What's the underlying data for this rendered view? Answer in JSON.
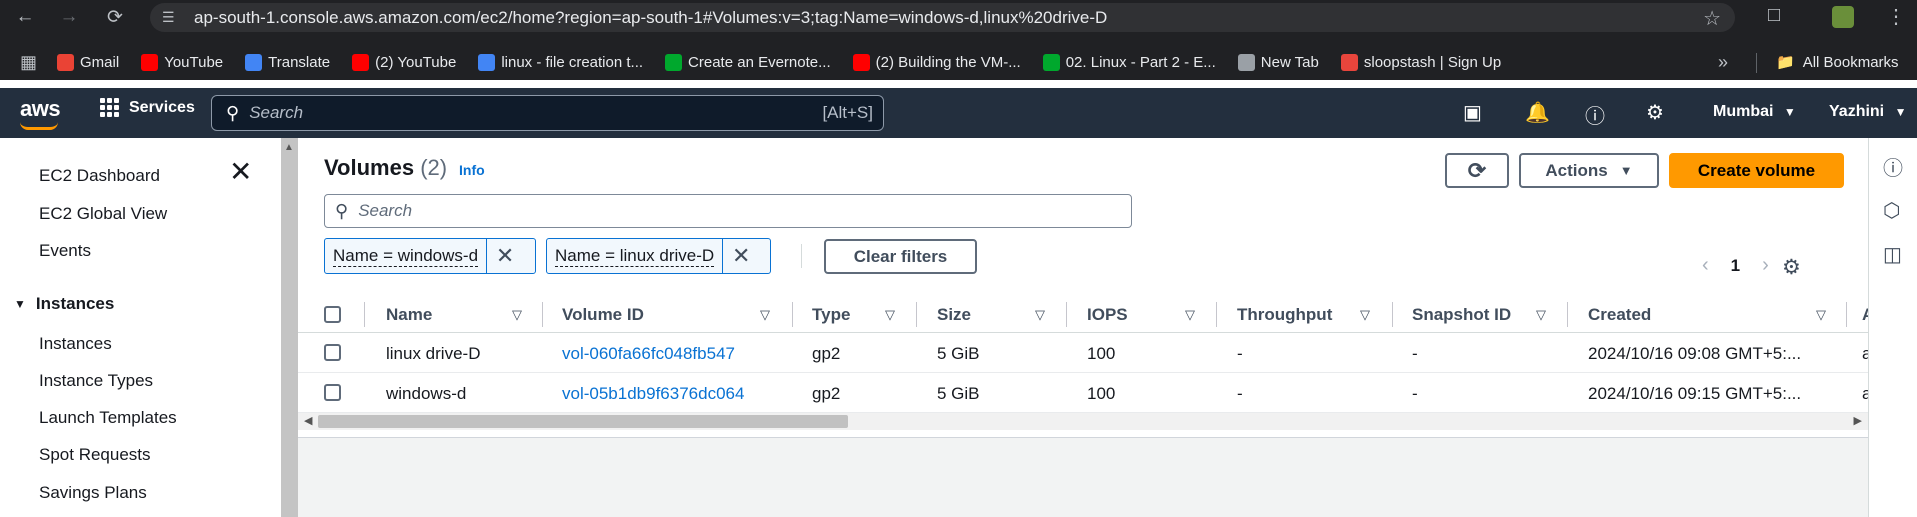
{
  "browser": {
    "url": "ap-south-1.console.aws.amazon.com/ec2/home?region=ap-south-1#Volumes:v=3;tag:Name=windows-d,linux%20drive-D",
    "bookmarks": [
      {
        "label": "Gmail",
        "icon": "gmail-icon",
        "color": "#ea4335"
      },
      {
        "label": "YouTube",
        "icon": "youtube-icon",
        "color": "#ff0000"
      },
      {
        "label": "Translate",
        "icon": "translate-icon",
        "color": "#4285f4"
      },
      {
        "label": "(2) YouTube",
        "icon": "youtube-icon",
        "color": "#ff0000"
      },
      {
        "label": "linux - file creation t...",
        "icon": "docs-icon",
        "color": "#4285f4"
      },
      {
        "label": "Create an Evernote...",
        "icon": "evernote-icon",
        "color": "#00a82d"
      },
      {
        "label": "(2) Building the VM-...",
        "icon": "youtube-icon",
        "color": "#ff0000"
      },
      {
        "label": "02. Linux - Part 2 - E...",
        "icon": "evernote-icon",
        "color": "#00a82d"
      },
      {
        "label": "New Tab",
        "icon": "globe-icon",
        "color": "#9aa0a6"
      },
      {
        "label": "sloopstash | Sign Up",
        "icon": "sloopstash-icon",
        "color": "#e8453c"
      }
    ],
    "all_bookmarks": "All Bookmarks"
  },
  "aws": {
    "logo": "aws",
    "services": "Services",
    "search_placeholder": "Search",
    "search_shortcut": "[Alt+S]",
    "region": "Mumbai",
    "user": "Yazhini"
  },
  "sidenav": {
    "items_top": [
      "EC2 Dashboard",
      "EC2 Global View",
      "Events"
    ],
    "section": "Instances",
    "items_instances": [
      "Instances",
      "Instance Types",
      "Launch Templates",
      "Spot Requests",
      "Savings Plans"
    ]
  },
  "main": {
    "title": "Volumes",
    "count": "(2)",
    "info": "Info",
    "actions": "Actions",
    "create": "Create volume",
    "filter_placeholder": "Search",
    "tokens": [
      "Name = windows-d",
      "Name = linux drive-D"
    ],
    "clear_filters": "Clear filters",
    "page": "1",
    "columns": [
      "Name",
      "Volume ID",
      "Type",
      "Size",
      "IOPS",
      "Throughput",
      "Snapshot ID",
      "Created",
      "A"
    ],
    "rows": [
      {
        "name": "linux drive-D",
        "volume_id": "vol-060fa66fc048fb547",
        "type": "gp2",
        "size": "5 GiB",
        "iops": "100",
        "throughput": "-",
        "snapshot": "-",
        "created": "2024/10/16 09:08 GMT+5:...",
        "extra": "a"
      },
      {
        "name": "windows-d",
        "volume_id": "vol-05b1db9f6376dc064",
        "type": "gp2",
        "size": "5 GiB",
        "iops": "100",
        "throughput": "-",
        "snapshot": "-",
        "created": "2024/10/16 09:15 GMT+5:...",
        "extra": "a"
      }
    ]
  },
  "colors": {
    "accent": "#ff9900",
    "link": "#0972d3",
    "header": "#232f3e"
  }
}
